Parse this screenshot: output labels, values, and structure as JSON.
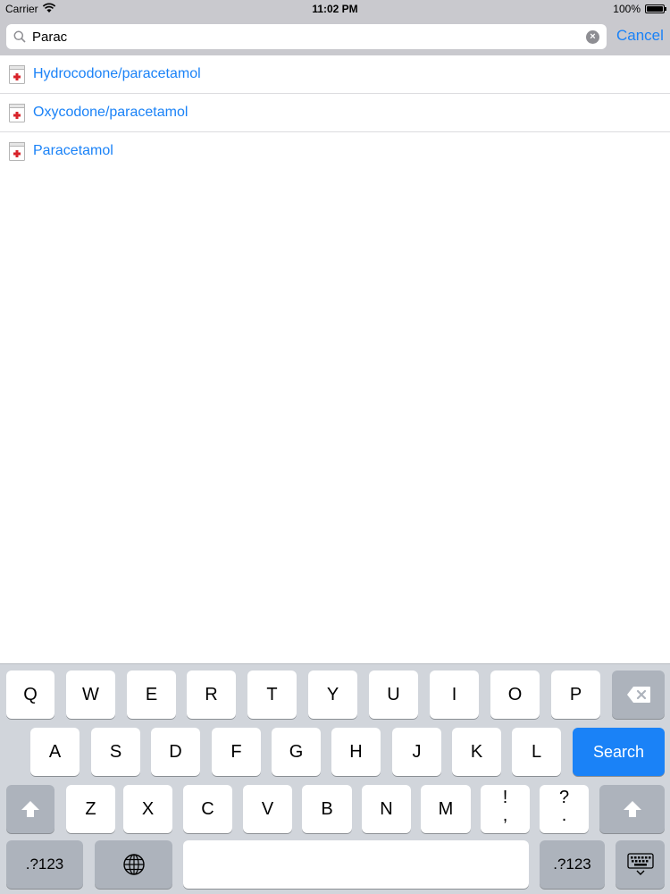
{
  "status_bar": {
    "carrier": "Carrier",
    "time": "11:02 PM",
    "battery": "100%"
  },
  "search": {
    "value": "Parac",
    "cancel_label": "Cancel"
  },
  "results": [
    {
      "label": "Hydrocodone/paracetamol",
      "icon": "medicine-bottle-icon"
    },
    {
      "label": "Oxycodone/paracetamol",
      "icon": "medicine-bottle-icon"
    },
    {
      "label": "Paracetamol",
      "icon": "medicine-bottle-icon"
    }
  ],
  "keyboard": {
    "row1": [
      "Q",
      "W",
      "E",
      "R",
      "T",
      "Y",
      "U",
      "I",
      "O",
      "P"
    ],
    "row2": [
      "A",
      "S",
      "D",
      "F",
      "G",
      "H",
      "J",
      "K",
      "L"
    ],
    "row3": [
      "Z",
      "X",
      "C",
      "V",
      "B",
      "N",
      "M"
    ],
    "punct1": [
      "!",
      ","
    ],
    "punct2": [
      "?",
      "."
    ],
    "search_label": "Search",
    "numbers_label": ".?123",
    "numbers_label_right": ".?123"
  },
  "colors": {
    "accent": "#1a82f7",
    "header_bg": "#c9c9ce",
    "keyboard_bg": "#d1d5db"
  }
}
